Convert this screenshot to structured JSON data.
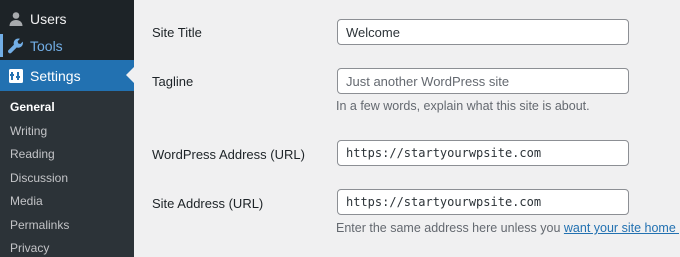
{
  "sidebar": {
    "top_items": [
      {
        "label": "Users",
        "icon": "user-icon"
      },
      {
        "label": "Tools",
        "icon": "wrench-icon"
      },
      {
        "label": "Settings",
        "icon": "settings-icon"
      }
    ],
    "submenu": [
      {
        "label": "General",
        "current": true
      },
      {
        "label": "Writing"
      },
      {
        "label": "Reading"
      },
      {
        "label": "Discussion"
      },
      {
        "label": "Media"
      },
      {
        "label": "Permalinks"
      },
      {
        "label": "Privacy"
      }
    ],
    "colors": {
      "bg": "#1d2327",
      "submenu_bg": "#2c3338",
      "active": "#2271b1",
      "hover_blue": "#72aee6"
    }
  },
  "form": {
    "site_title": {
      "label": "Site Title",
      "value": "Welcome"
    },
    "tagline": {
      "label": "Tagline",
      "placeholder": "Just another WordPress site",
      "description": "In a few words, explain what this site is about."
    },
    "wp_address": {
      "label": "WordPress Address (URL)",
      "value": "https://startyourwpsite.com"
    },
    "site_address": {
      "label": "Site Address (URL)",
      "value": "https://startyourwpsite.com",
      "description_prefix": "Enter the same address here unless you ",
      "description_link": "want your site home page"
    }
  }
}
